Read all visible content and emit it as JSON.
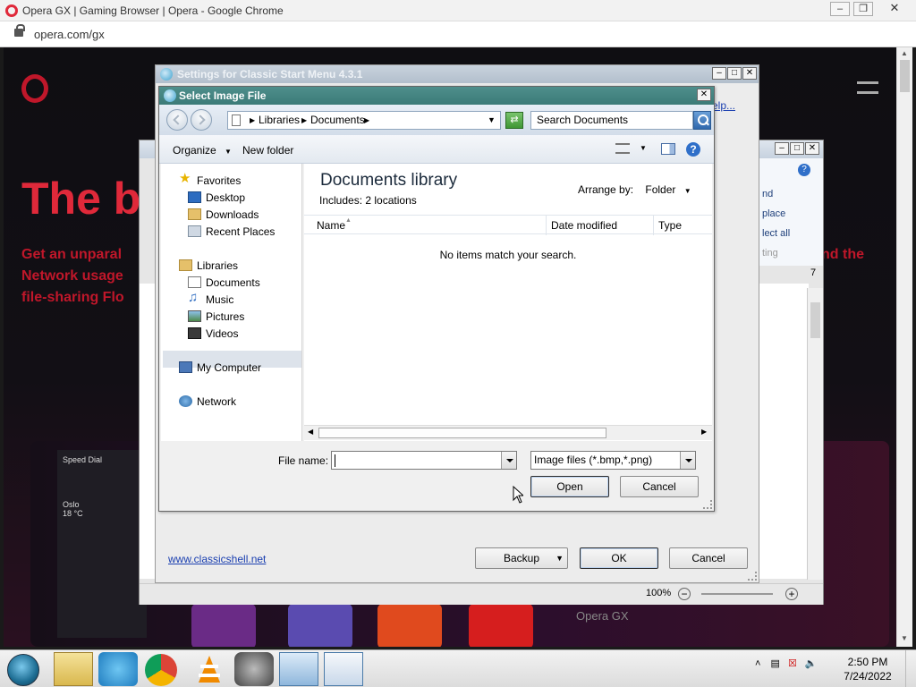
{
  "browser": {
    "title": "Opera GX | Gaming Browser | Opera - Google Chrome",
    "url": "opera.com/gx"
  },
  "page": {
    "hero_text": "The b",
    "sub_text": "Get an unparal Network usage file-sharing Flo",
    "sub_right": "nd the",
    "speed_dial_label": "Speed Dial",
    "weather_city": "Oslo",
    "weather_temp": "18 °C",
    "tile_label": "Opera GX"
  },
  "wordpad": {
    "ribbon_items": [
      "nd",
      "place",
      "lect all",
      "ting"
    ],
    "ruler_end": "7",
    "zoom": "100%"
  },
  "settings_dialog": {
    "title": "Settings for Classic Start Menu 4.3.1",
    "help_link": "elp...",
    "website_link": "www.classicshell.net",
    "backup_label": "Backup",
    "ok_label": "OK",
    "cancel_label": "Cancel"
  },
  "file_dialog": {
    "title": "Select Image File",
    "breadcrumb": [
      "Libraries",
      "Documents"
    ],
    "search_placeholder": "Search Documents",
    "organize_label": "Organize",
    "new_folder_label": "New folder",
    "nav": {
      "favorites": "Favorites",
      "desktop": "Desktop",
      "downloads": "Downloads",
      "recent_places": "Recent Places",
      "libraries": "Libraries",
      "documents": "Documents",
      "music": "Music",
      "pictures": "Pictures",
      "videos": "Videos",
      "my_computer": "My Computer",
      "network": "Network"
    },
    "library_title": "Documents library",
    "includes_label": "Includes:",
    "includes_link": "2 locations",
    "arrange_label": "Arrange by:",
    "arrange_value": "Folder",
    "columns": [
      "Name",
      "Date modified",
      "Type"
    ],
    "empty_message": "No items match your search.",
    "file_name_label": "File name:",
    "file_name_value": "",
    "file_type_value": "Image files (*.bmp,*.png)",
    "open_label": "Open",
    "cancel_label": "Cancel"
  },
  "taskbar": {
    "time": "2:50 PM",
    "date": "7/24/2022"
  },
  "colors": {
    "opera_red": "#e0293a",
    "file_dialog_title": "#4f8f8c",
    "link_blue": "#1a3fb0"
  }
}
